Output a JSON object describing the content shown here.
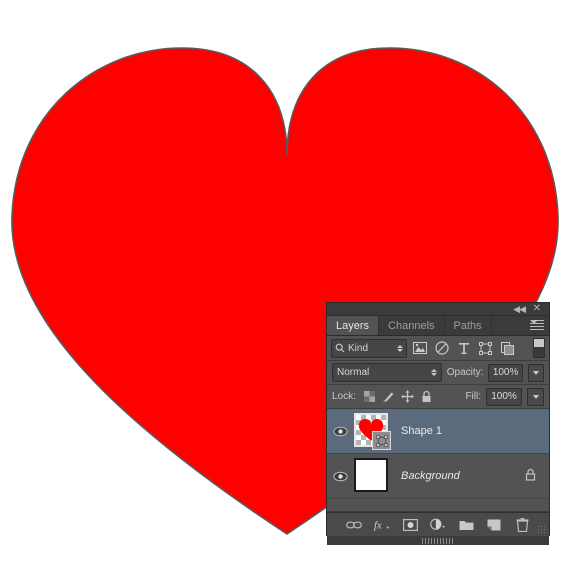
{
  "document": {
    "artwork": {
      "shape_name": "heart",
      "fill_color": "#FF0000",
      "stroke_color": "#5a5a5a",
      "background_color": "#FFFFFF"
    }
  },
  "panel": {
    "window_controls": {
      "collapse_label": "◀◀",
      "close_label": "✕"
    },
    "tabs": [
      {
        "label": "Layers",
        "active": true
      },
      {
        "label": "Channels",
        "active": false
      },
      {
        "label": "Paths",
        "active": false
      }
    ],
    "menu_label": "panel-menu",
    "filter": {
      "kind_label": "Kind",
      "icons": [
        "pixel-layer-filter-icon",
        "adjustment-layer-filter-icon",
        "type-layer-filter-icon",
        "shape-layer-filter-icon",
        "smart-object-filter-icon"
      ],
      "toggle_label": "filter-toggle"
    },
    "blend": {
      "mode": "Normal",
      "opacity_label": "Opacity:",
      "opacity_value": "100%"
    },
    "lock": {
      "label": "Lock:",
      "icons": [
        "lock-transparent-pixels-icon",
        "lock-image-pixels-icon",
        "lock-position-icon",
        "lock-all-icon"
      ],
      "fill_label": "Fill:",
      "fill_value": "100%"
    },
    "layers": [
      {
        "name": "Shape 1",
        "visible": true,
        "selected": true,
        "italic": false,
        "locked": false,
        "thumbnail": "heart-on-transparent",
        "badge": "vector-shape-mask"
      },
      {
        "name": "Background",
        "visible": true,
        "selected": false,
        "italic": true,
        "locked": true,
        "thumbnail": "white-solid",
        "badge": ""
      }
    ],
    "bottom_toolbar": [
      "link-layers-icon",
      "layer-style-fx-icon",
      "add-layer-mask-icon",
      "new-adjustment-layer-icon",
      "new-group-icon",
      "new-layer-icon",
      "delete-layer-icon"
    ]
  },
  "colors": {
    "panel_bg": "#535353",
    "panel_chrome": "#3b3b3b",
    "selected_row": "#5b6a7d",
    "text": "#d4d4d4",
    "accent_red": "#FF0000"
  }
}
